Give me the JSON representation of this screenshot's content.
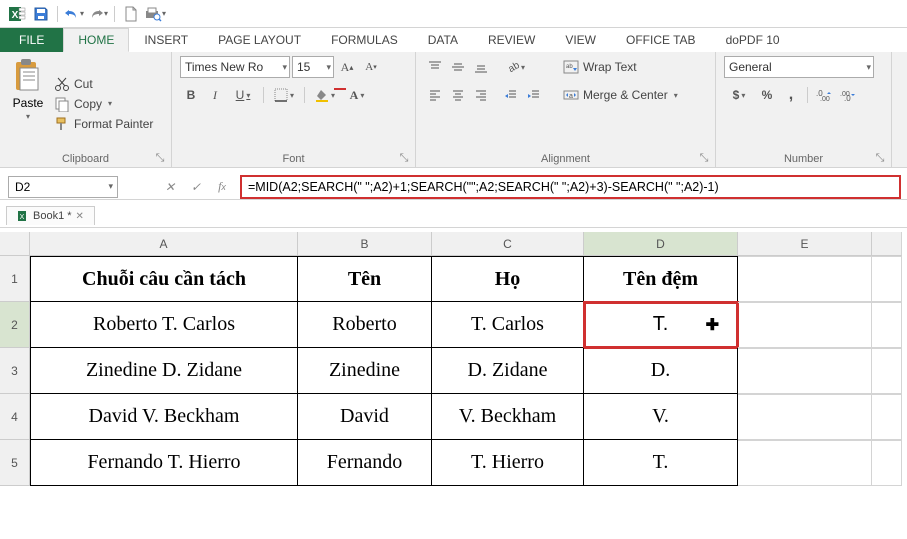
{
  "qat": {
    "icons": [
      "excel",
      "save",
      "undo",
      "redo",
      "new",
      "print-preview"
    ]
  },
  "tabs": {
    "file": "FILE",
    "items": [
      "HOME",
      "INSERT",
      "PAGE LAYOUT",
      "FORMULAS",
      "DATA",
      "REVIEW",
      "VIEW",
      "OFFICE TAB",
      "doPDF 10"
    ],
    "active": 0
  },
  "ribbon": {
    "clipboard": {
      "paste": "Paste",
      "cut": "Cut",
      "copy": "Copy",
      "format_painter": "Format Painter",
      "label": "Clipboard"
    },
    "font": {
      "name": "Times New Ro",
      "size": "15",
      "label": "Font"
    },
    "alignment": {
      "wrap": "Wrap Text",
      "merge": "Merge & Center",
      "label": "Alignment"
    },
    "number": {
      "format": "General",
      "label": "Number"
    }
  },
  "formula_bar": {
    "name_box": "D2",
    "formula": "=MID(A2;SEARCH(\" \";A2)+1;SEARCH(\"\";A2;SEARCH(\" \";A2)+3)-SEARCH(\" \";A2)-1)"
  },
  "workbook_tab": "Book1 *",
  "columns": [
    "A",
    "B",
    "C",
    "D",
    "E"
  ],
  "row_headers": [
    "1",
    "2",
    "3",
    "4",
    "5"
  ],
  "table": {
    "headers": [
      "Chuỗi câu cần tách",
      "Tên",
      "Họ",
      "Tên đệm"
    ],
    "rows": [
      [
        "Roberto T. Carlos",
        "Roberto",
        "T. Carlos",
        "T."
      ],
      [
        "Zinedine D. Zidane",
        "Zinedine",
        "D. Zidane",
        "D."
      ],
      [
        "David V. Beckham",
        "David",
        "V. Beckham",
        "V."
      ],
      [
        "Fernando T. Hierro",
        "Fernando",
        "T. Hierro",
        "T."
      ]
    ]
  },
  "selected_cell": "D2"
}
